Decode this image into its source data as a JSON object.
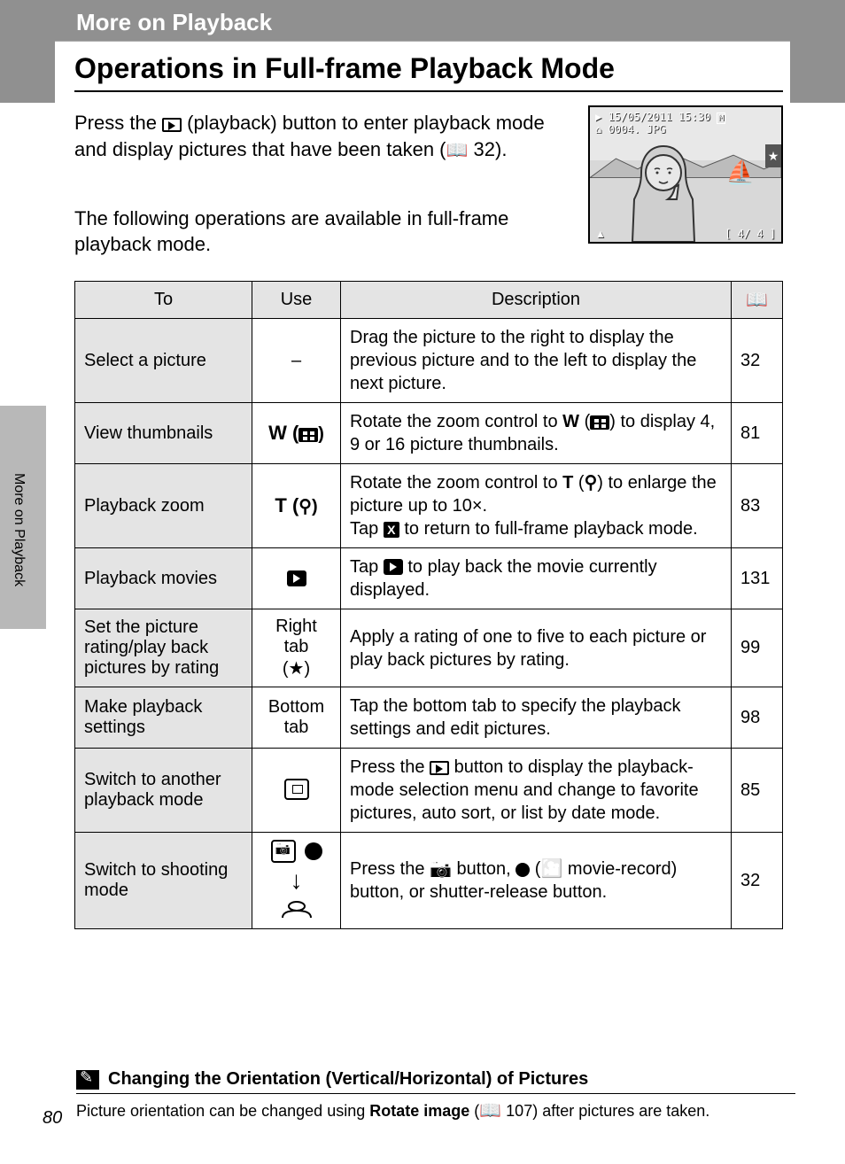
{
  "header": {
    "section": "More on Playback"
  },
  "sidebar": {
    "label": "More on Playback"
  },
  "title": "Operations in Full-frame Playback Mode",
  "intro1_a": "Press the ",
  "intro1_b": " (playback) button to enter playback mode and display pictures that have been taken (",
  "intro1_c": " 32).",
  "intro2": "The following operations are available in full-frame playback mode.",
  "preview": {
    "date": "15/05/2011 15:30",
    "file": "0004. JPG",
    "counter": "4/   4",
    "uparrow": "▲"
  },
  "table": {
    "head": {
      "to": "To",
      "use": "Use",
      "desc": "Description",
      "pg_icon": "book"
    },
    "rows": [
      {
        "to": "Select a picture",
        "use_plain": "–",
        "desc": "Drag the picture to the right to display the previous picture and to the left to display the next picture.",
        "pg": "32"
      },
      {
        "to": "View thumbnails",
        "use_prefix": "W (",
        "use_icon": "thumb",
        "use_suffix": ")",
        "desc_a": "Rotate the zoom control to ",
        "desc_bold1": "W",
        "desc_b": " (",
        "desc_icon1": "thumb",
        "desc_c": ") to display 4, 9 or 16 picture thumbnails.",
        "pg": "81"
      },
      {
        "to": "Playback zoom",
        "use_prefix": "T (",
        "use_mag": "⚲",
        "use_suffix": ")",
        "desc_a": "Rotate the zoom control to ",
        "desc_bold1": "T",
        "desc_b": " (",
        "desc_mag": "⚲",
        "desc_c": ") to enlarge the picture up to 10×.",
        "desc_line2_a": "Tap ",
        "desc_line2_b": " to return to full-frame playback mode.",
        "desc_x": "X",
        "pg": "83"
      },
      {
        "to": "Playback movies",
        "use_playfill": true,
        "desc_a": "Tap ",
        "desc_b": " to play back the movie currently displayed.",
        "pg": "131"
      },
      {
        "to": "Set the picture rating/play back pictures by rating",
        "use_line1": "Right tab",
        "use_line2": "(★)",
        "desc": "Apply a rating of one to five to each picture or play back pictures by rating.",
        "pg": "99"
      },
      {
        "to": "Make playback settings",
        "use_line1": "Bottom",
        "use_line2": "tab",
        "desc": "Tap the bottom tab to specify the playback settings and edit pictures.",
        "pg": "98"
      },
      {
        "to": "Switch to another playback mode",
        "use_dblplay": true,
        "desc_a": "Press the ",
        "desc_b": " button to display the playback-mode selection menu and change to favorite pictures, auto sort, or list by date mode.",
        "pg": "85"
      },
      {
        "to": "Switch to shooting mode",
        "use_shooting": true,
        "desc_a": "Press the ",
        "desc_cam": "📷",
        "desc_b": " button, ",
        "desc_dot": true,
        "desc_c": " (",
        "desc_mr": "🎦",
        "desc_d": " movie-record) button, or shutter-release button.",
        "pg": "32"
      }
    ]
  },
  "note": {
    "title": "Changing the Orientation (Vertical/Horizontal) of Pictures",
    "body_a": "Picture orientation can be changed using ",
    "body_bold": "Rotate image",
    "body_b": " (",
    "body_c": " 107) after pictures are taken."
  },
  "page_number": "80"
}
